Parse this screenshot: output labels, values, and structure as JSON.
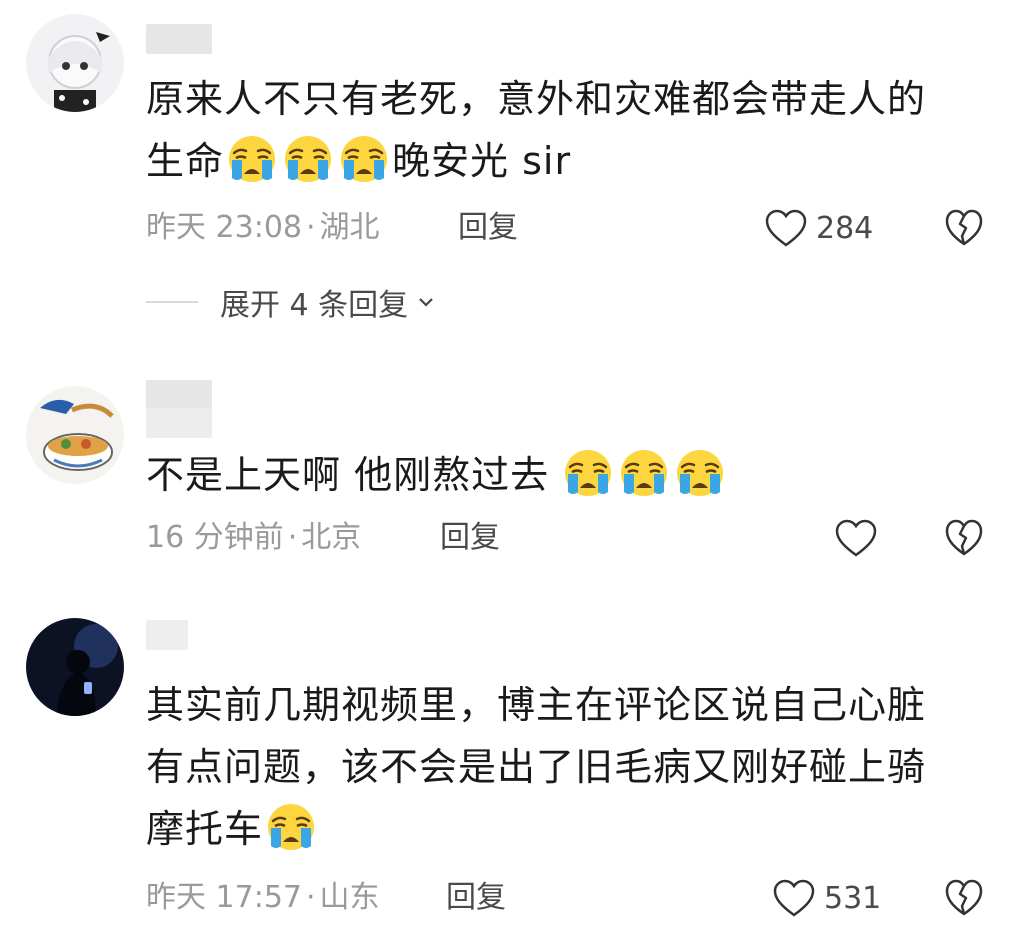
{
  "comments": [
    {
      "text_line1": "原来人不只有老死，意外和灾难都会带走人的",
      "text_line2_prefix": "生命",
      "text_line2_suffix": "晚安光 sir",
      "emoji_count": 3,
      "time": "昨天 23:08",
      "location": "湖北",
      "reply_label": "回复",
      "likes": "284",
      "expand_label": "展开 4 条回复"
    },
    {
      "text_line1": "不是上天啊 他刚熬过去",
      "emoji_count": 3,
      "time": "16 分钟前",
      "location": "北京",
      "reply_label": "回复",
      "likes": ""
    },
    {
      "text_line1": "其实前几期视频里，博主在评论区说自己心脏",
      "text_line2": "有点问题，该不会是出了旧毛病又刚好碰上骑",
      "text_line3": "摩托车",
      "emoji_count": 1,
      "time": "昨天 17:57",
      "location": "山东",
      "reply_label": "回复",
      "likes": "531"
    }
  ],
  "meta_separator": "·",
  "icons": {
    "like": "heart-outline-icon",
    "dislike": "broken-heart-icon",
    "emoji": "crying-face-emoji",
    "expand": "chevron-down-icon"
  },
  "colors": {
    "meta_text": "#9a9a9a",
    "emoji_yellow": "#fcd53f",
    "emoji_tear": "#3ba6e6"
  }
}
